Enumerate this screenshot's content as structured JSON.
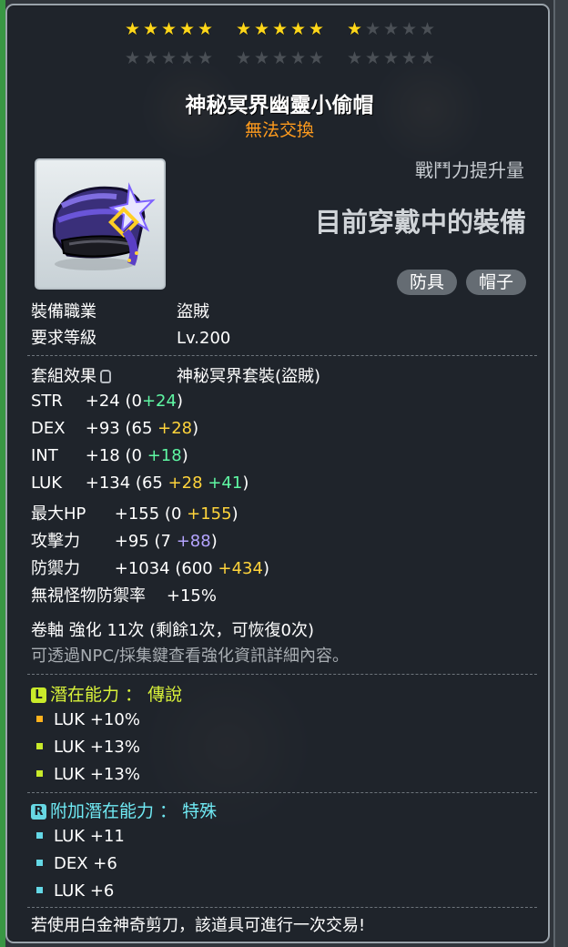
{
  "stars": {
    "row1": [
      "gold",
      "gold",
      "gold",
      "gold",
      "gold",
      "gold",
      "gold",
      "gold",
      "gold",
      "gold",
      "gold",
      "empty",
      "empty",
      "empty",
      "empty"
    ],
    "row2": [
      "empty",
      "empty",
      "empty",
      "empty",
      "empty",
      "empty",
      "empty",
      "empty",
      "empty",
      "empty",
      "empty",
      "empty",
      "empty",
      "empty",
      "empty"
    ]
  },
  "item": {
    "name": "神秘冥界幽靈小偷帽",
    "trade_status": "無法交換",
    "power_label": "戰鬥力提升量",
    "equipped_text": "目前穿戴中的裝備",
    "tags": [
      "防具",
      "帽子"
    ],
    "icon": "purple-thief-hat-icon"
  },
  "requirements": {
    "job_label": "裝備職業",
    "job_value": "盜賊",
    "level_label": "要求等級",
    "level_value": "Lv.200"
  },
  "set": {
    "label": "套組效果",
    "value": "神秘冥界套裝(盜賊)"
  },
  "stats": {
    "str": {
      "name": "STR",
      "total": "+24",
      "open": "(0",
      "add1": "+24",
      "close": ")"
    },
    "dex": {
      "name": "DEX",
      "total": "+93",
      "open": "(65",
      "add1": "+28",
      "close": ")"
    },
    "int": {
      "name": "INT",
      "total": "+18",
      "open": "(0",
      "add1": "+18",
      "close": ")"
    },
    "luk": {
      "name": "LUK",
      "total": "+134",
      "open": "(65",
      "add1": "+28",
      "add2": "+41",
      "close": ")"
    },
    "hp": {
      "name": "最大HP",
      "total": "+155",
      "open": "(0",
      "add1": "+155",
      "close": ")"
    },
    "att": {
      "name": "攻擊力",
      "total": "+95",
      "open": "(7",
      "add1": "+88",
      "close": ")"
    },
    "def": {
      "name": "防禦力",
      "total": "+1034",
      "open": "(600",
      "add1": "+434",
      "close": ")"
    },
    "ignore_def": {
      "name": "無視怪物防禦率",
      "total": "+15%"
    }
  },
  "enhance": {
    "line": "卷軸 強化 11次 (剩餘1次，可恢復0次)",
    "hint": "可透過NPC/採集鍵查看強化資訊詳細內容。"
  },
  "potential": {
    "badge": "L",
    "title": "潛在能力 ： 傳說",
    "lines": [
      "LUK +10%",
      "LUK +13%",
      "LUK +13%"
    ]
  },
  "bonus_potential": {
    "badge": "R",
    "title": "附加潛在能力 ： 特殊",
    "lines": [
      "LUK +11",
      "DEX +6",
      "LUK +6"
    ]
  },
  "footer": "若使用白金神奇剪刀，該道具可進行一次交易!"
}
